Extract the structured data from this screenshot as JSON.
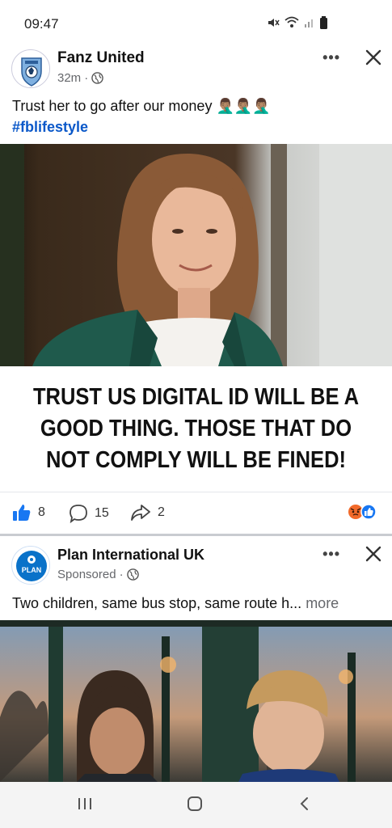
{
  "status_bar": {
    "time": "09:47"
  },
  "post1": {
    "author": "Fanz United",
    "time_ago": "32m",
    "caption": "Trust her to go after our money",
    "caption_emoji": "🤦🏽‍♂️🤦🏽‍♂️🤦🏽‍♂️",
    "hashtag": "#fblifestyle",
    "meme_text": "TRUST US DIGITAL ID WILL BE A GOOD THING. THOSE THAT DO NOT COMPLY WILL BE FINED!",
    "likes": "8",
    "comments": "15",
    "shares": "2"
  },
  "post2": {
    "author": "Plan International UK",
    "label": "Sponsored",
    "avatar_text": "PLAN",
    "caption": "Two children, same bus stop, same route h...",
    "more": "more"
  },
  "colors": {
    "accent_blue": "#0a58c9",
    "like_blue": "#1877f2",
    "angry_orange": "#f26a2a"
  }
}
